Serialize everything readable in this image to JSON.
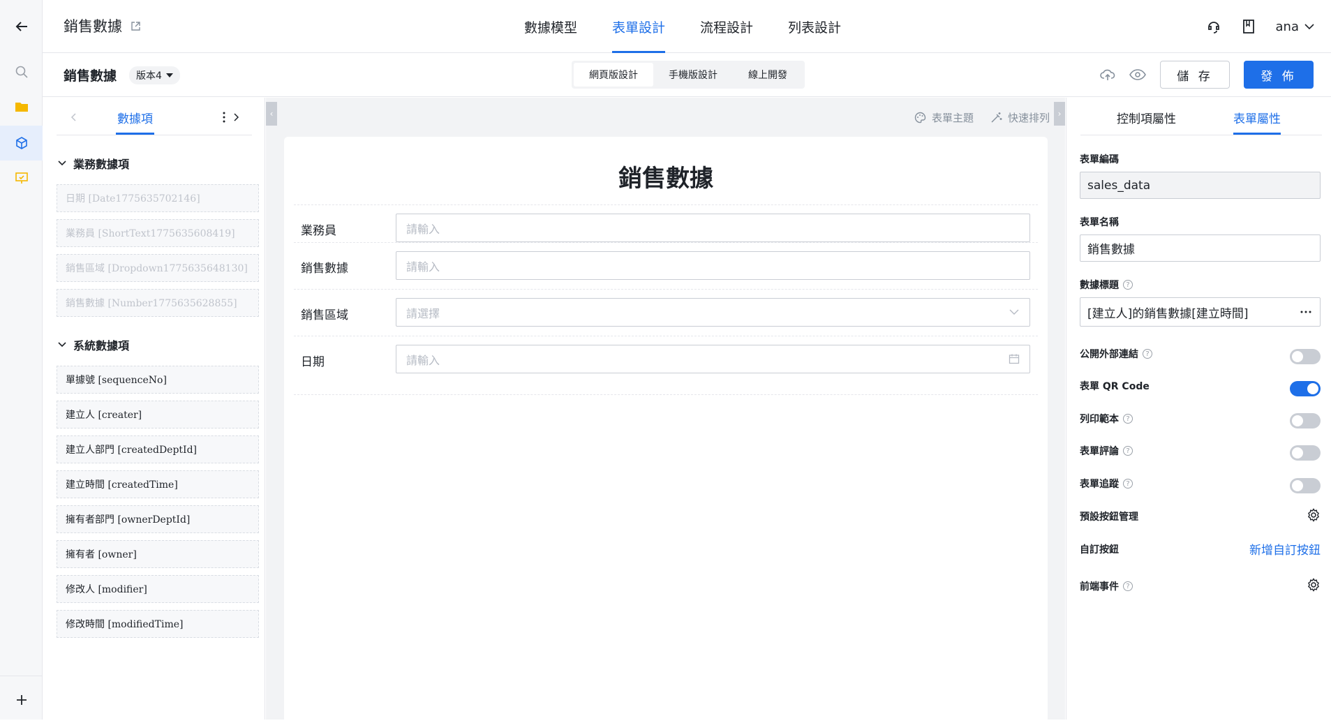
{
  "app": {
    "title": "銷售數據",
    "tabs": [
      "數據模型",
      "表單設計",
      "流程設計",
      "列表設計"
    ],
    "active_tab": "表單設計",
    "user": "ana"
  },
  "subbar": {
    "form_name": "銷售數據",
    "version": "版本4",
    "modes": [
      "網頁版設計",
      "手機版設計",
      "線上開發"
    ],
    "active_mode": "網頁版設計",
    "save_label": "儲 存",
    "publish_label": "發 佈"
  },
  "left_panel": {
    "tab_label": "數據項",
    "business_group": "業務數據項",
    "business_fields": [
      "日期 [Date1775635702146]",
      "業務員 [ShortText1775635608419]",
      "銷售區域 [Dropdown1775635648130]",
      "銷售數據 [Number1775635628855]"
    ],
    "system_group": "系統數據項",
    "system_fields": [
      "單據號 [sequenceNo]",
      "建立人 [creater]",
      "建立人部門 [createdDeptId]",
      "建立時間 [createdTime]",
      "擁有者部門 [ownerDeptId]",
      "擁有者 [owner]",
      "修改人 [modifier]",
      "修改時間 [modifiedTime]"
    ]
  },
  "canvas": {
    "tools": [
      "表單主題",
      "快速排列"
    ],
    "form_title": "銷售數據",
    "rows": [
      {
        "label": "業務員",
        "placeholder": "請輸入",
        "kind": "text"
      },
      {
        "label": "銷售數據",
        "placeholder": "請輸入",
        "kind": "text"
      },
      {
        "label": "銷售區域",
        "placeholder": "請選擇",
        "kind": "select"
      },
      {
        "label": "日期",
        "placeholder": "請輸入",
        "kind": "date"
      }
    ]
  },
  "right_panel": {
    "tabs": [
      "控制項屬性",
      "表單屬性"
    ],
    "active_tab": "表單屬性",
    "form_code_label": "表單編碼",
    "form_code": "sales_data",
    "form_name_label": "表單名稱",
    "form_name": "銷售數據",
    "data_title_label": "數據標題",
    "data_title": "[建立人]的銷售數據[建立時間]",
    "toggles": [
      {
        "label": "公開外部連結",
        "help": true,
        "on": false
      },
      {
        "label": "表單 QR Code",
        "help": false,
        "on": true
      },
      {
        "label": "列印範本",
        "help": true,
        "on": false
      },
      {
        "label": "表單評論",
        "help": true,
        "on": false
      },
      {
        "label": "表單追蹤",
        "help": true,
        "on": false
      }
    ],
    "default_buttons_label": "預設按鈕管理",
    "custom_button_label": "自訂按鈕",
    "custom_button_link": "新增自訂按鈕",
    "frontend_events_label": "前端事件"
  },
  "colors": {
    "accent": "#1e6fe8",
    "border": "#e5e6eb",
    "canvas_bg": "#f2f3f5"
  }
}
